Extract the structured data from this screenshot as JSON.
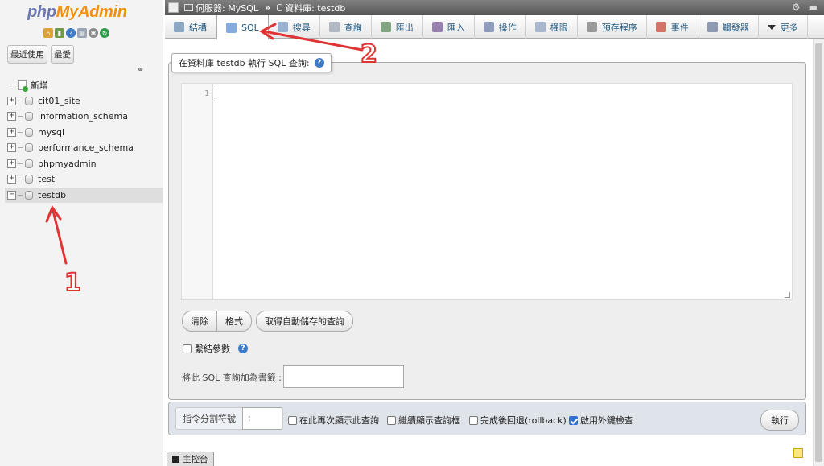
{
  "sidebar": {
    "logo": {
      "php": "php",
      "my": "My",
      "admin": "Admin"
    },
    "quick_icons": [
      "home-icon",
      "logout-icon",
      "help-icon",
      "docs-icon",
      "settings-icon",
      "reload-icon"
    ],
    "buttons": {
      "recent": "最近使用",
      "favorites": "最愛"
    },
    "tree": {
      "new_label": "新增",
      "databases": [
        "cit01_site",
        "information_schema",
        "mysql",
        "performance_schema",
        "phpmyadmin",
        "test",
        "testdb"
      ],
      "selected": "testdb"
    }
  },
  "topbar": {
    "server_label": "伺服器: MySQL",
    "separator": "»",
    "database_label": "資料庫: testdb"
  },
  "tabs": [
    {
      "label": "結構",
      "icon": "structure-icon"
    },
    {
      "label": "SQL",
      "icon": "sql-icon"
    },
    {
      "label": "搜尋",
      "icon": "search-icon"
    },
    {
      "label": "查詢",
      "icon": "query-icon"
    },
    {
      "label": "匯出",
      "icon": "export-icon"
    },
    {
      "label": "匯入",
      "icon": "import-icon"
    },
    {
      "label": "操作",
      "icon": "wrench-icon"
    },
    {
      "label": "權限",
      "icon": "privileges-icon"
    },
    {
      "label": "預存程序",
      "icon": "routines-icon"
    },
    {
      "label": "事件",
      "icon": "events-icon"
    },
    {
      "label": "觸發器",
      "icon": "triggers-icon"
    },
    {
      "label": "更多",
      "icon": "more-icon"
    }
  ],
  "active_tab": "SQL",
  "sql_form": {
    "legend": "在資料庫 testdb 執行 SQL 查詢:",
    "line_number": "1",
    "clear_label": "清除",
    "format_label": "格式",
    "autosave_label": "取得自動儲存的查詢",
    "bind_params_label": "繫結參數",
    "bookmark_label": "將此 SQL 查詢加為書籤 :"
  },
  "footer": {
    "delimiter_label": "指令分割符號",
    "delimiter_value": ";",
    "show_again_label": "在此再次顯示此查詢",
    "retain_box_label": "繼續顯示查詢框",
    "rollback_label": "完成後回退(rollback)",
    "fk_check_label": "啟用外鍵檢查",
    "go_label": "執行",
    "fk_checked": true
  },
  "console": {
    "label": "主控台"
  },
  "annotations": {
    "arrow1": "1",
    "arrow2": "2",
    "color": "#e03434"
  },
  "colors": {
    "topbar": "#6b6b6b",
    "link": "#235a81",
    "panel": "#eeeeee",
    "footer": "#dfe3ea"
  }
}
